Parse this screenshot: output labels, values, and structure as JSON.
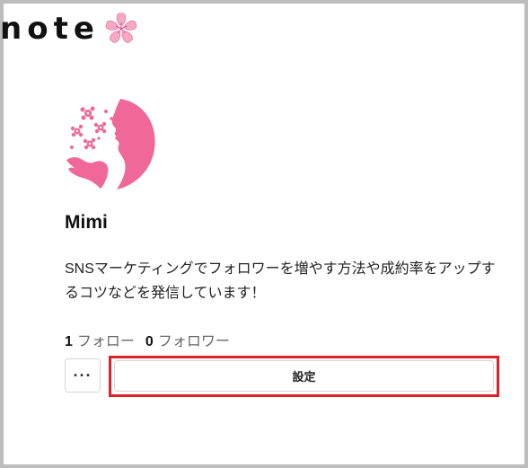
{
  "header": {
    "logo_text": "note",
    "logo_icon": "sakura-flower-icon"
  },
  "profile": {
    "avatar_icon": "woman-silhouette-with-flowers-icon",
    "name": "Mimi",
    "bio": "SNSマーケティングでフォロワーを増やす方法や成約率をアップするコツなどを発信しています！",
    "follow_count": "1",
    "follow_label": "フォロー",
    "follower_count": "0",
    "follower_label": "フォロワー"
  },
  "actions": {
    "more_label": "···",
    "settings_label": "設定"
  },
  "colors": {
    "accent_pink": "#f0689a",
    "highlight_red": "#e0202a",
    "frame_gray": "#bdbdbd"
  }
}
